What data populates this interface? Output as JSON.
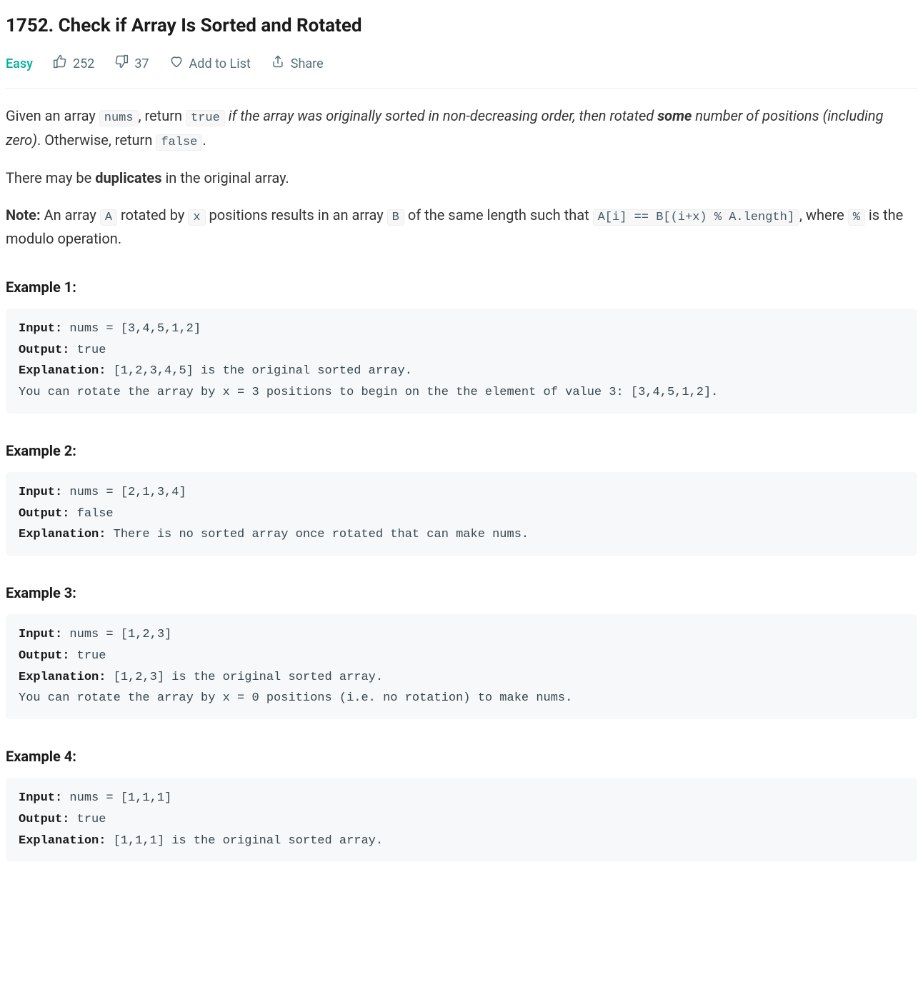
{
  "title": "1752. Check if Array Is Sorted and Rotated",
  "meta": {
    "difficulty": "Easy",
    "likes": "252",
    "dislikes": "37",
    "add_to_list": "Add to List",
    "share": "Share"
  },
  "description": {
    "p1_a": "Given an array ",
    "p1_code1": "nums",
    "p1_b": ", return ",
    "p1_code2": "true",
    "p1_c": " if the array was originally sorted in non-decreasing order, then rotated ",
    "p1_strong": "some",
    "p1_d": " number of positions (including zero)",
    "p1_e": ". Otherwise, return ",
    "p1_code3": "false",
    "p1_f": ".",
    "p2_a": "There may be ",
    "p2_strong": "duplicates",
    "p2_b": " in the original array.",
    "p3_strong": "Note:",
    "p3_a": " An array ",
    "p3_code1": "A",
    "p3_b": " rotated by ",
    "p3_code2": "x",
    "p3_c": " positions results in an array ",
    "p3_code3": "B",
    "p3_d": " of the same length such that ",
    "p3_code4": "A[i] == B[(i+x) % A.length]",
    "p3_e": ", where ",
    "p3_code5": "%",
    "p3_f": " is the modulo operation."
  },
  "examples": [
    {
      "heading": "Example 1:",
      "input_label": "Input:",
      "input_text": " nums = [3,4,5,1,2]",
      "output_label": "Output:",
      "output_text": " true",
      "explanation_label": "Explanation:",
      "explanation_text": " [1,2,3,4,5] is the original sorted array.\nYou can rotate the array by x = 3 positions to begin on the the element of value 3: [3,4,5,1,2]."
    },
    {
      "heading": "Example 2:",
      "input_label": "Input:",
      "input_text": " nums = [2,1,3,4]",
      "output_label": "Output:",
      "output_text": " false",
      "explanation_label": "Explanation:",
      "explanation_text": " There is no sorted array once rotated that can make nums."
    },
    {
      "heading": "Example 3:",
      "input_label": "Input:",
      "input_text": " nums = [1,2,3]",
      "output_label": "Output:",
      "output_text": " true",
      "explanation_label": "Explanation:",
      "explanation_text": " [1,2,3] is the original sorted array.\nYou can rotate the array by x = 0 positions (i.e. no rotation) to make nums."
    },
    {
      "heading": "Example 4:",
      "input_label": "Input:",
      "input_text": " nums = [1,1,1]",
      "output_label": "Output:",
      "output_text": " true",
      "explanation_label": "Explanation:",
      "explanation_text": " [1,1,1] is the original sorted array."
    }
  ]
}
